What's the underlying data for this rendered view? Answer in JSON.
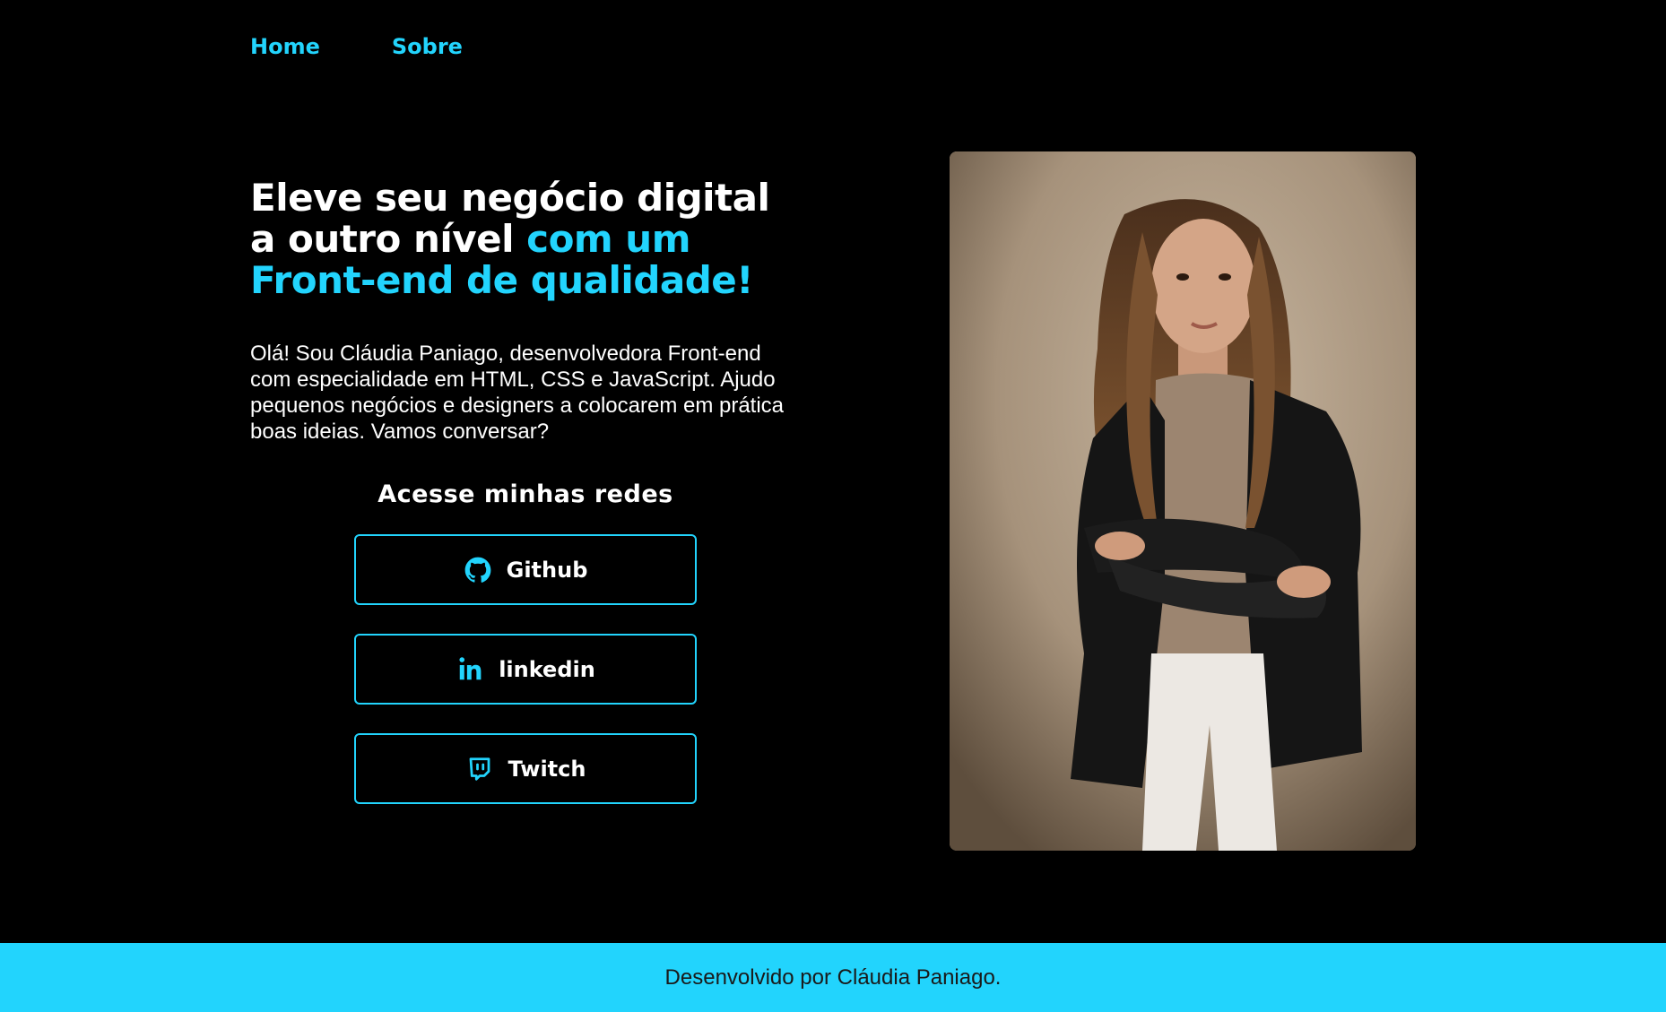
{
  "nav": {
    "items": [
      {
        "label": "Home"
      },
      {
        "label": "Sobre"
      }
    ]
  },
  "hero": {
    "headline_white": "Eleve seu negócio digital a outro nível ",
    "headline_accent": "com um Front-end de qualidade!",
    "intro": "Olá! Sou Cláudia Paniago, desenvolvedora Front-end com especialidade em HTML, CSS e JavaScript. Ajudo pequenos negócios e designers a colocarem em prática boas ideias. Vamos conversar?",
    "networks_title": "Acesse minhas redes",
    "links": [
      {
        "label": "Github",
        "icon": "github-icon"
      },
      {
        "label": "linkedin",
        "icon": "linkedin-icon"
      },
      {
        "label": "Twitch",
        "icon": "twitch-icon"
      }
    ]
  },
  "footer": {
    "text": "Desenvolvido por Cláudia Paniago."
  },
  "colors": {
    "accent": "#22D4FD",
    "background": "#000000",
    "text": "#FFFFFF"
  }
}
